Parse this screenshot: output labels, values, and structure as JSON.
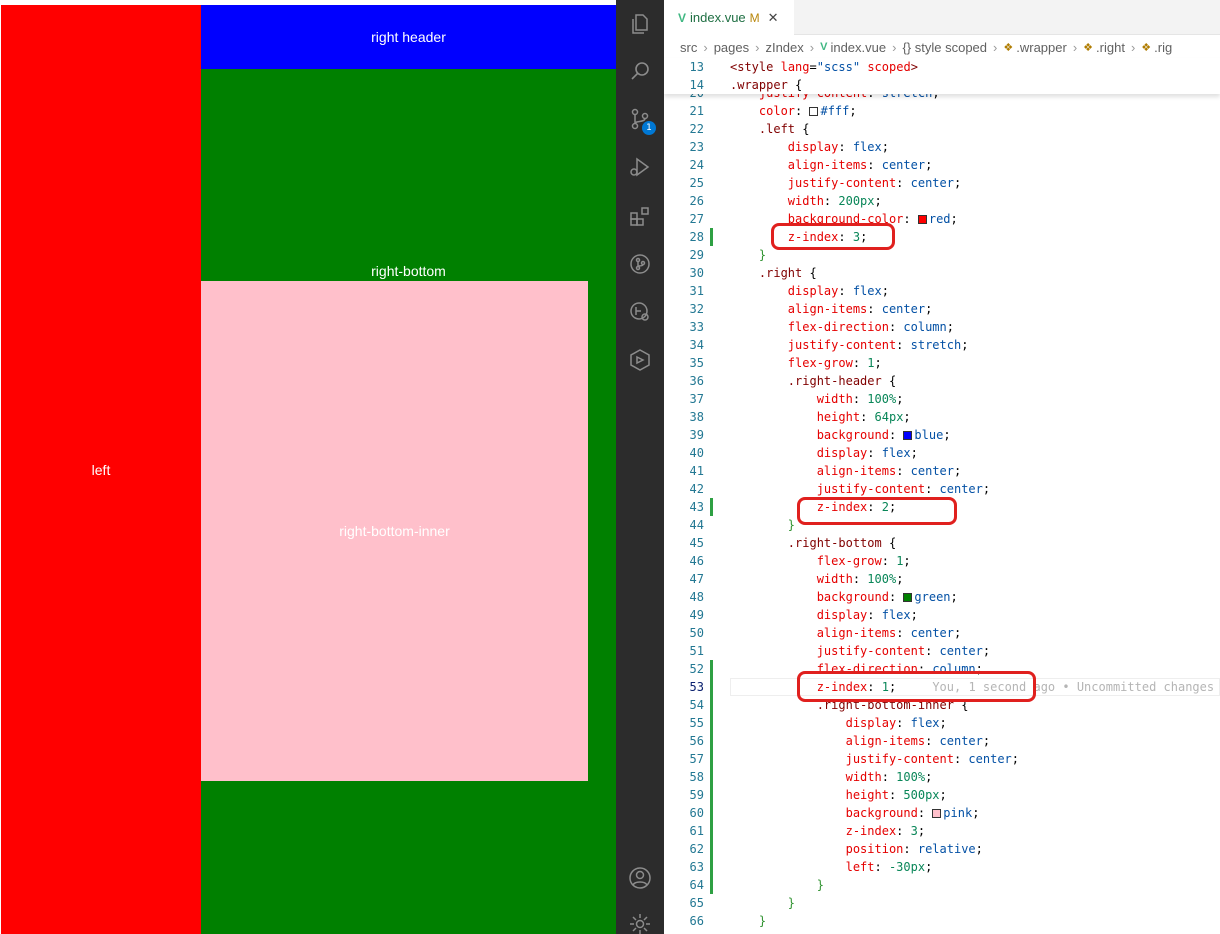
{
  "preview": {
    "left_label": "left",
    "header_label": "right header",
    "bottom_label": "right-bottom",
    "inner_label": "right-bottom-inner"
  },
  "activity_bar": {
    "items": [
      {
        "icon": "explorer-icon"
      },
      {
        "icon": "search-icon"
      },
      {
        "icon": "source-control-icon",
        "badge": "1"
      },
      {
        "icon": "run-debug-icon"
      },
      {
        "icon": "extensions-icon"
      },
      {
        "icon": "git-graph-icon"
      },
      {
        "icon": "remote-explorer-icon"
      },
      {
        "icon": "codegeex-icon"
      }
    ],
    "bottom_items": [
      {
        "icon": "account-icon"
      },
      {
        "icon": "settings-gear-icon"
      }
    ]
  },
  "tab": {
    "name": "index.vue",
    "modified": "M",
    "close": "✕"
  },
  "breadcrumb": [
    "src",
    "pages",
    "zIndex",
    "index.vue",
    "{} style scoped",
    ".wrapper",
    ".right",
    ".rig"
  ],
  "sticky_lines": [
    {
      "n": "13",
      "html": "<span class=\"t-tag\">&lt;style</span> <span class=\"t-attr\">lang</span>=<span class=\"t-val\">\"scss\"</span> <span class=\"t-attr\">scoped</span><span class=\"t-tag\">&gt;</span>"
    },
    {
      "n": "14",
      "html": "<span class=\"t-sel\">.wrapper</span> {"
    }
  ],
  "code_lines": [
    {
      "n": "20",
      "html": "    <span class=\"t-prop\">justify-content</span>: <span class=\"t-val\">stretch</span>;"
    },
    {
      "n": "21",
      "html": "    <span class=\"t-prop\">color</span>: <span class=\"swatch\" style=\"background:#fff\"></span><span class=\"t-val\">#fff</span>;"
    },
    {
      "n": "22",
      "html": "    <span class=\"t-sel\">.left</span> {"
    },
    {
      "n": "23",
      "html": "        <span class=\"t-prop\">display</span>: <span class=\"t-val\">flex</span>;"
    },
    {
      "n": "24",
      "html": "        <span class=\"t-prop\">align-items</span>: <span class=\"t-val\">center</span>;"
    },
    {
      "n": "25",
      "html": "        <span class=\"t-prop\">justify-content</span>: <span class=\"t-val\">center</span>;"
    },
    {
      "n": "26",
      "html": "        <span class=\"t-prop\">width</span>: <span class=\"t-num\">200px</span>;"
    },
    {
      "n": "27",
      "html": "        <span class=\"t-prop\">background-color</span>: <span class=\"swatch\" style=\"background:red\"></span><span class=\"t-val\">red</span>;"
    },
    {
      "n": "28",
      "html": "        <span class=\"t-prop\">z-index</span>: <span class=\"t-num\">3</span>;"
    },
    {
      "n": "29",
      "html": "    <span class=\"t-brace\">}</span>"
    },
    {
      "n": "30",
      "html": "    <span class=\"t-sel\">.right</span> {"
    },
    {
      "n": "31",
      "html": "        <span class=\"t-prop\">display</span>: <span class=\"t-val\">flex</span>;"
    },
    {
      "n": "32",
      "html": "        <span class=\"t-prop\">align-items</span>: <span class=\"t-val\">center</span>;"
    },
    {
      "n": "33",
      "html": "        <span class=\"t-prop\">flex-direction</span>: <span class=\"t-val\">column</span>;"
    },
    {
      "n": "34",
      "html": "        <span class=\"t-prop\">justify-content</span>: <span class=\"t-val\">stretch</span>;"
    },
    {
      "n": "35",
      "html": "        <span class=\"t-prop\">flex-grow</span>: <span class=\"t-num\">1</span>;"
    },
    {
      "n": "36",
      "html": "        <span class=\"t-sel\">.right-header</span> {"
    },
    {
      "n": "37",
      "html": "            <span class=\"t-prop\">width</span>: <span class=\"t-num\">100%</span>;"
    },
    {
      "n": "38",
      "html": "            <span class=\"t-prop\">height</span>: <span class=\"t-num\">64px</span>;"
    },
    {
      "n": "39",
      "html": "            <span class=\"t-prop\">background</span>: <span class=\"swatch\" style=\"background:blue\"></span><span class=\"t-val\">blue</span>;"
    },
    {
      "n": "40",
      "html": "            <span class=\"t-prop\">display</span>: <span class=\"t-val\">flex</span>;"
    },
    {
      "n": "41",
      "html": "            <span class=\"t-prop\">align-items</span>: <span class=\"t-val\">center</span>;"
    },
    {
      "n": "42",
      "html": "            <span class=\"t-prop\">justify-content</span>: <span class=\"t-val\">center</span>;"
    },
    {
      "n": "43",
      "html": "            <span class=\"t-prop\">z-index</span>: <span class=\"t-num\">2</span>;"
    },
    {
      "n": "44",
      "html": "        <span class=\"t-brace\">}</span>"
    },
    {
      "n": "45",
      "html": "        <span class=\"t-sel\">.right-bottom</span> {"
    },
    {
      "n": "46",
      "html": "            <span class=\"t-prop\">flex-grow</span>: <span class=\"t-num\">1</span>;"
    },
    {
      "n": "47",
      "html": "            <span class=\"t-prop\">width</span>: <span class=\"t-num\">100%</span>;"
    },
    {
      "n": "48",
      "html": "            <span class=\"t-prop\">background</span>: <span class=\"swatch\" style=\"background:green\"></span><span class=\"t-val\">green</span>;"
    },
    {
      "n": "49",
      "html": "            <span class=\"t-prop\">display</span>: <span class=\"t-val\">flex</span>;"
    },
    {
      "n": "50",
      "html": "            <span class=\"t-prop\">align-items</span>: <span class=\"t-val\">center</span>;"
    },
    {
      "n": "51",
      "html": "            <span class=\"t-prop\">justify-content</span>: <span class=\"t-val\">center</span>;"
    },
    {
      "n": "52",
      "html": "            <span class=\"t-prop\">flex-direction</span>: <span class=\"t-val\">column</span>;"
    },
    {
      "n": "53",
      "html": "            <span class=\"t-prop\">z-index</span>: <span class=\"t-num\">1</span>;     <span class=\"blame\">You, 1 second ago • Uncommitted changes</span>",
      "active": true
    },
    {
      "n": "54",
      "html": "            <span class=\"t-sel\">.right-bottom-inner</span> {"
    },
    {
      "n": "55",
      "html": "                <span class=\"t-prop\">display</span>: <span class=\"t-val\">flex</span>;"
    },
    {
      "n": "56",
      "html": "                <span class=\"t-prop\">align-items</span>: <span class=\"t-val\">center</span>;"
    },
    {
      "n": "57",
      "html": "                <span class=\"t-prop\">justify-content</span>: <span class=\"t-val\">center</span>;"
    },
    {
      "n": "58",
      "html": "                <span class=\"t-prop\">width</span>: <span class=\"t-num\">100%</span>;"
    },
    {
      "n": "59",
      "html": "                <span class=\"t-prop\">height</span>: <span class=\"t-num\">500px</span>;"
    },
    {
      "n": "60",
      "html": "                <span class=\"t-prop\">background</span>: <span class=\"swatch\" style=\"background:pink\"></span><span class=\"t-val\">pink</span>;"
    },
    {
      "n": "61",
      "html": "                <span class=\"t-prop\">z-index</span>: <span class=\"t-num\">3</span>;"
    },
    {
      "n": "62",
      "html": "                <span class=\"t-prop\">position</span>: <span class=\"t-val\">relative</span>;"
    },
    {
      "n": "63",
      "html": "                <span class=\"t-prop\">left</span>: <span class=\"t-num\">-30px</span>;"
    },
    {
      "n": "64",
      "html": "            <span class=\"t-brace\">}</span>"
    },
    {
      "n": "65",
      "html": "        <span class=\"t-brace\">}</span>"
    },
    {
      "n": "66",
      "html": "    <span class=\"t-brace\">}</span>"
    }
  ]
}
